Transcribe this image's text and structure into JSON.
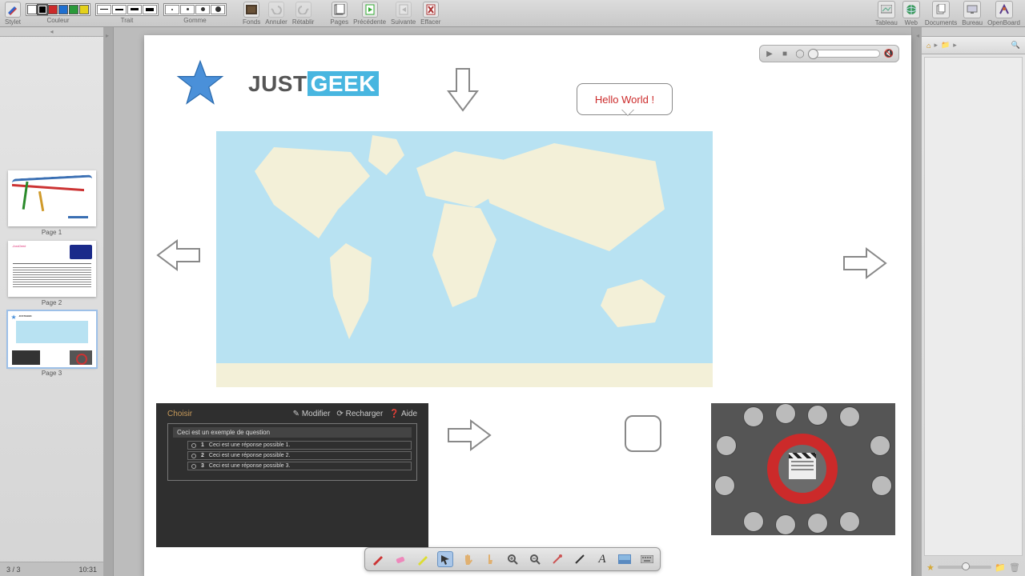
{
  "toolbar": {
    "stylus_label": "Stylet",
    "color_label": "Couleur",
    "stroke_label": "Trait",
    "eraser_label": "Gomme",
    "backgrounds_label": "Fonds",
    "undo_label": "Annuler",
    "redo_label": "Rétablir",
    "pages_label": "Pages",
    "prev_label": "Précédente",
    "next_label": "Suivante",
    "erase_label": "Effacer",
    "colors": [
      "#ffffff",
      "#000000",
      "#cc2a2a",
      "#1f6fd0",
      "#2a9a3a",
      "#e4d11a"
    ],
    "board_label": "Tableau",
    "web_label": "Web",
    "documents_label": "Documents",
    "desktop_label": "Bureau",
    "openboard_label": "OpenBoard"
  },
  "thumbs": {
    "p1": "Page 1",
    "p2": "Page 2",
    "p3": "Page 3",
    "counter": "3 / 3",
    "time": "10:31"
  },
  "canvas": {
    "brand_a": "JUST",
    "brand_b": "GEEK",
    "hello": "Hello World !"
  },
  "quiz": {
    "title": "Choisir",
    "edit": "Modifier",
    "reload": "Recharger",
    "help": "Aide",
    "question": "Ceci est un exemple de question",
    "answers": [
      "Ceci est une réponse possible 1.",
      "Ceci est une réponse possible 2.",
      "Ceci est une réponse possible 3."
    ],
    "nums": [
      "1",
      "2",
      "3"
    ]
  },
  "bottombar": {
    "text_tool": "A"
  }
}
